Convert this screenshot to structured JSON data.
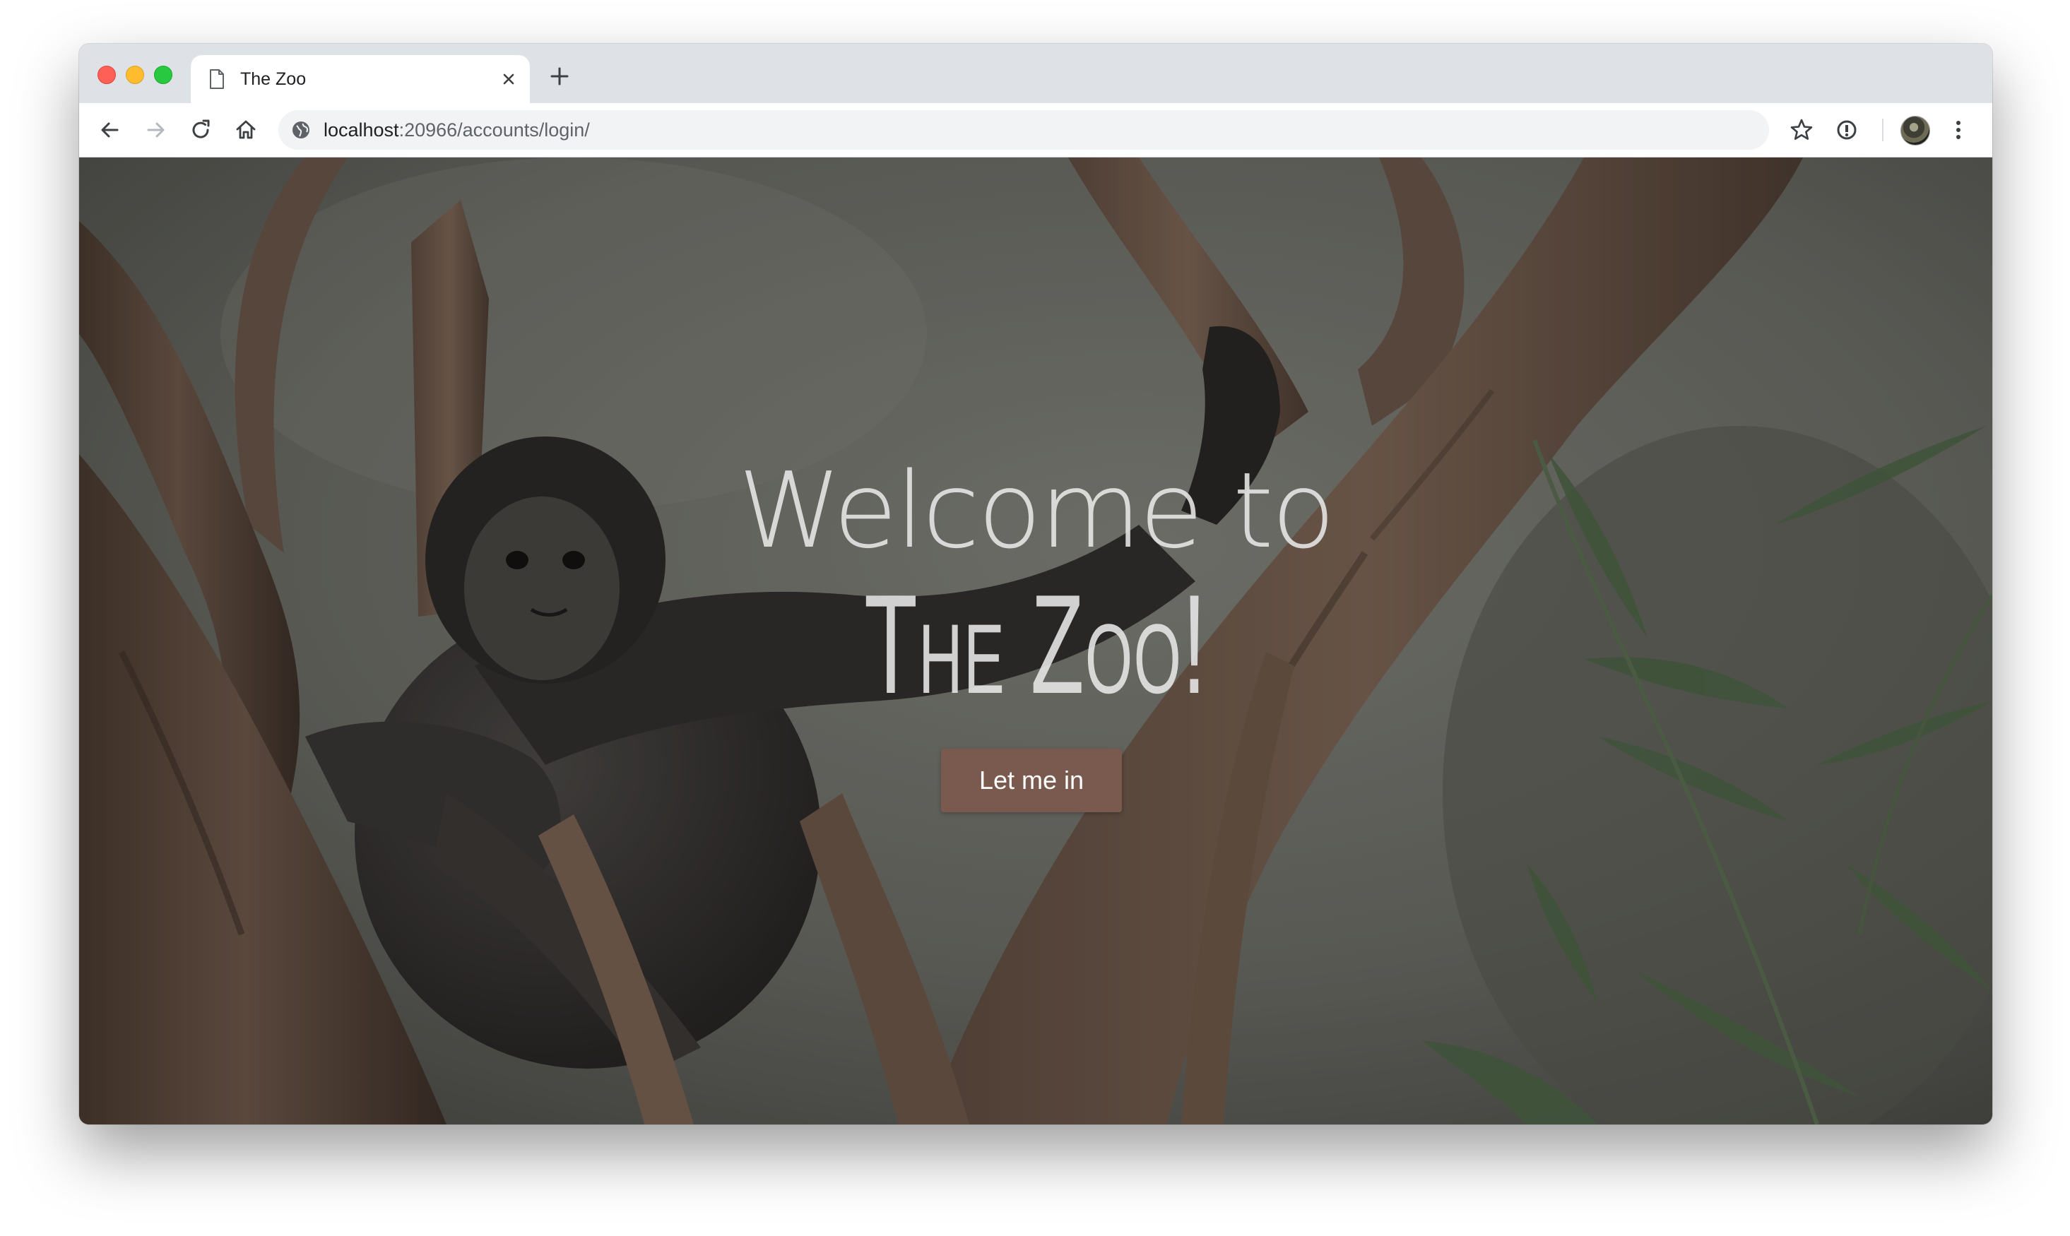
{
  "browser": {
    "tab": {
      "title": "The Zoo",
      "favicon": "page-icon"
    },
    "new_tab_icon": "plus-icon",
    "toolbar": {
      "back_icon": "arrow-left-icon",
      "forward_icon": "arrow-right-icon",
      "reload_icon": "reload-icon",
      "home_icon": "home-icon",
      "bookmark_icon": "star-icon",
      "extension_icon": "password-manager-icon",
      "menu_icon": "kebab-menu-icon"
    },
    "address": {
      "security_icon": "globe-icon",
      "host": "localhost",
      "path": ":20966/accounts/login/"
    }
  },
  "page": {
    "heading_line1": "Welcome to",
    "heading_line2": "The Zoo!",
    "cta_label": "Let me in",
    "colors": {
      "cta_background": "#7a5a4f",
      "heading_text": "#e6e6e6"
    }
  }
}
